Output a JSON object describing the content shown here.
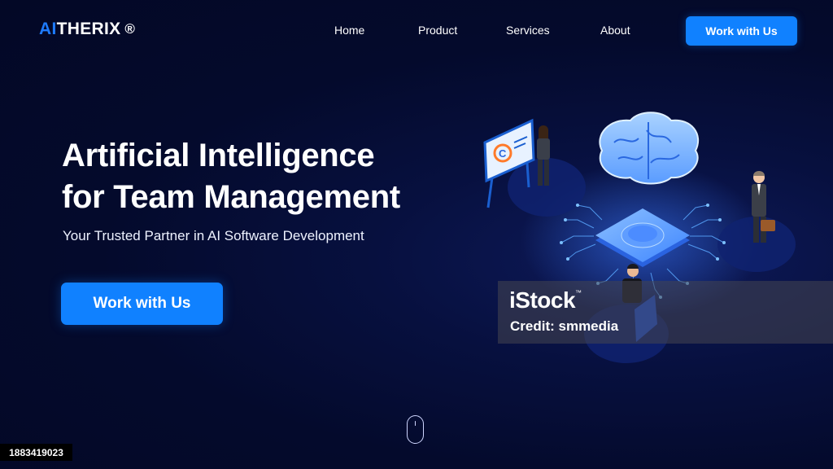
{
  "header": {
    "logo_ai": "AI",
    "logo_rest": "THERIX",
    "logo_reg": "®",
    "nav": [
      "Home",
      "Product",
      "Services",
      "About"
    ],
    "cta_label": "Work with Us"
  },
  "hero": {
    "title_line1": "Artificial Intelligence",
    "title_line2": "for Team Management",
    "subtitle": "Your Trusted Partner in AI Software Development",
    "cta_label": "Work with Us"
  },
  "watermark": {
    "brand": "iStock",
    "tm": "™",
    "credit": "Credit: smmedia",
    "image_id": "1883419023"
  },
  "illustration": {
    "board_letter": "C"
  },
  "colors": {
    "accent": "#1081ff",
    "logo_accent": "#1e7bff",
    "background": "#040a2c"
  }
}
